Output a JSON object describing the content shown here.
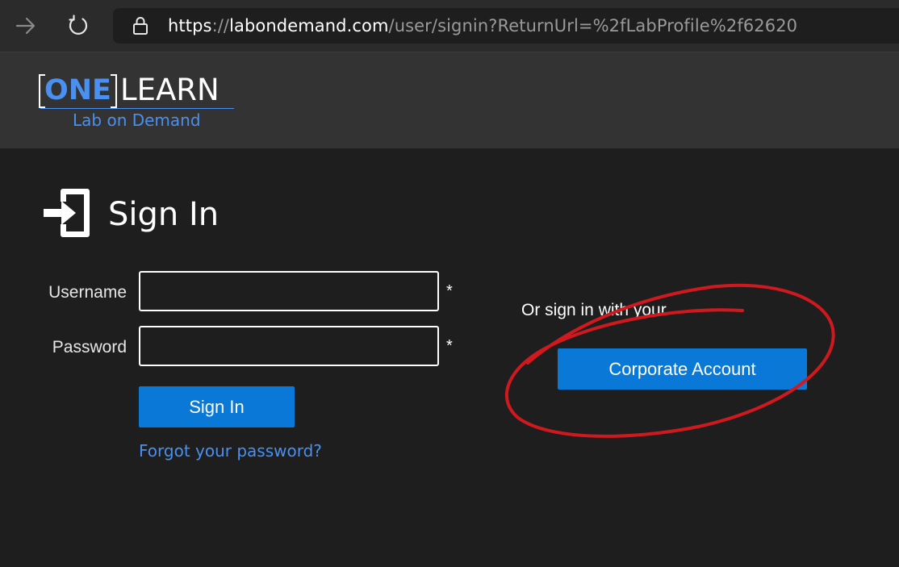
{
  "browser": {
    "nav_forward_icon": "arrow-right-icon",
    "refresh_icon": "refresh-icon",
    "lock_icon": "lock-icon",
    "url": {
      "scheme": "https",
      "separator": "://",
      "host": "labondemand.com",
      "path": "/user/signin?ReturnUrl=%2fLabProfile%2f62620"
    }
  },
  "header": {
    "logo_one": "ONE",
    "logo_learn": "LEARN",
    "logo_subtitle": "Lab on Demand"
  },
  "signin": {
    "icon": "sign-in-icon",
    "title": "Sign In",
    "username_label": "Username",
    "password_label": "Password",
    "username_value": "",
    "password_value": "",
    "required_marker": "*",
    "submit_label": "Sign In",
    "forgot_link": "Forgot your password?"
  },
  "alt_signin": {
    "prompt": "Or sign in with your",
    "corporate_label": "Corporate Account"
  },
  "colors": {
    "accent": "#0a78d7",
    "link": "#4a90f0",
    "background": "#1e1e1e",
    "header_bg": "#333333",
    "annotation": "#d0191f"
  }
}
